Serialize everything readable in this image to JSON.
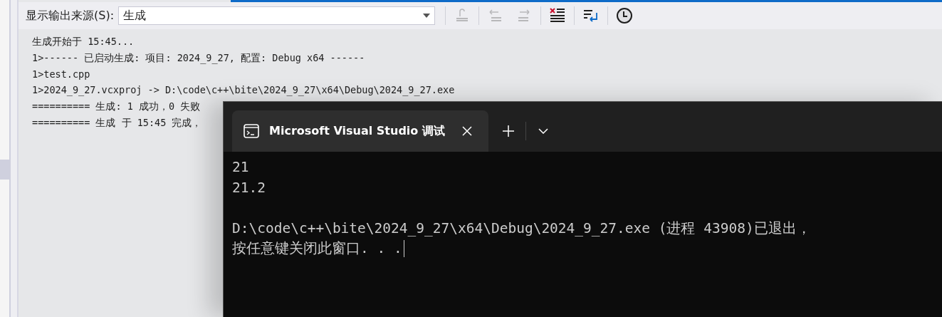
{
  "output_panel": {
    "source_label": "显示输出来源(S):",
    "source_value": "生成",
    "toolbar": [
      {
        "kind": "go-to-source",
        "disabled": true
      },
      {
        "kind": "previous",
        "disabled": true
      },
      {
        "kind": "next",
        "disabled": true
      },
      {
        "kind": "clear",
        "disabled": false
      },
      {
        "kind": "wrap",
        "disabled": false
      },
      {
        "kind": "clock",
        "disabled": false
      }
    ],
    "lines": [
      "生成开始于 15:45...",
      "1>------ 已启动生成: 项目: 2024_9_27, 配置: Debug x64 ------",
      "1>test.cpp",
      "1>2024_9_27.vcxproj -> D:\\code\\c++\\bite\\2024_9_27\\x64\\Debug\\2024_9_27.exe",
      "========== 生成: 1 成功，0 失败",
      "========== 生成 于 15:45 完成，"
    ]
  },
  "terminal": {
    "tab_title": "Microsoft Visual Studio 调试",
    "blocks": [
      [
        "21",
        "21.2"
      ],
      [
        "D:\\code\\c++\\bite\\2024_9_27\\x64\\Debug\\2024_9_27.exe (进程 43908)已退出，",
        "按任意键关闭此窗口. . ."
      ]
    ]
  }
}
